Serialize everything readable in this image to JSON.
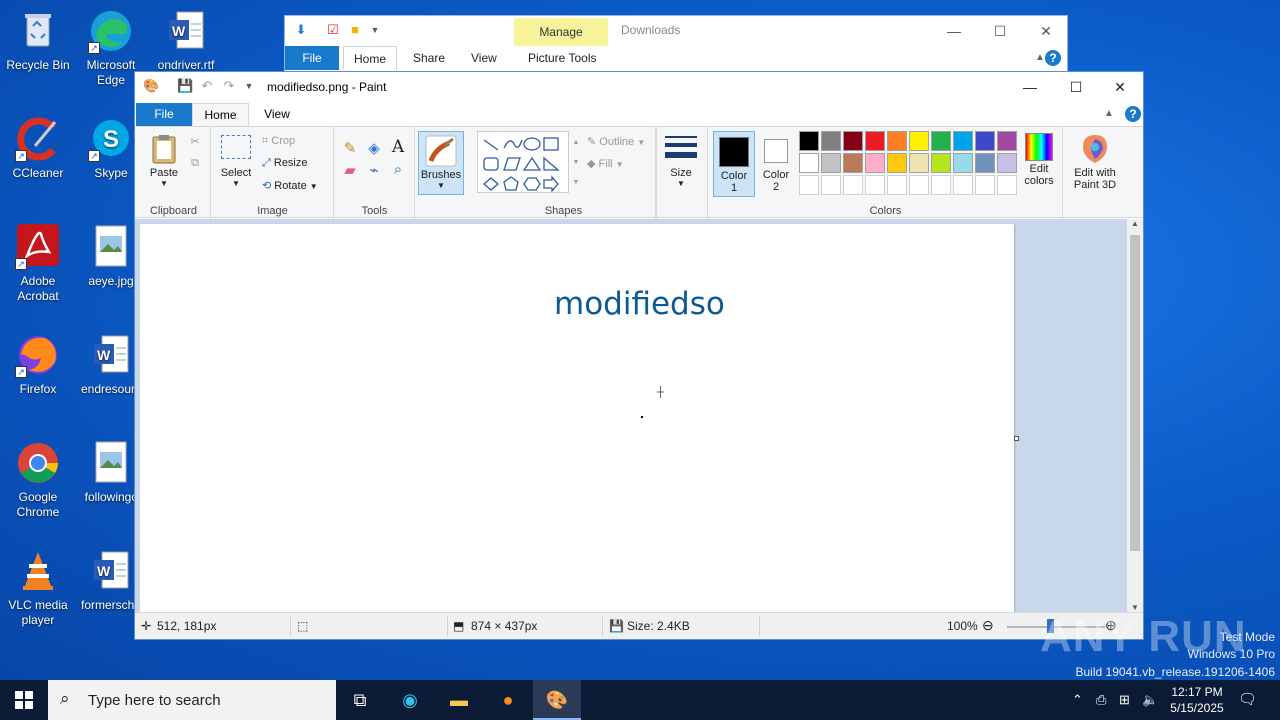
{
  "desktop": {
    "icons": [
      {
        "label1": "Recycle Bin",
        "label2": "",
        "icon": "recycle-bin-icon"
      },
      {
        "label1": "Microsoft",
        "label2": "Edge",
        "icon": "edge-icon"
      },
      {
        "label1": "ondriver.rtf",
        "label2": "",
        "icon": "word-doc-icon"
      },
      {
        "label1": "CCleaner",
        "label2": "",
        "icon": "ccleaner-icon"
      },
      {
        "label1": "Skype",
        "label2": "",
        "icon": "skype-icon"
      },
      {
        "label1": "Adobe",
        "label2": "Acrobat",
        "icon": "acrobat-icon"
      },
      {
        "label1": "aeye.jpg",
        "label2": "",
        "icon": "image-file-icon"
      },
      {
        "label1": "Firefox",
        "label2": "",
        "icon": "firefox-icon"
      },
      {
        "label1": "endresourc",
        "label2": "",
        "icon": "word-doc-icon"
      },
      {
        "label1": "Google",
        "label2": "Chrome",
        "icon": "chrome-icon"
      },
      {
        "label1": "followingc",
        "label2": "",
        "icon": "image-file-icon"
      },
      {
        "label1": "VLC media",
        "label2": "player",
        "icon": "vlc-icon"
      },
      {
        "label1": "formerscho",
        "label2": "",
        "icon": "word-doc-icon"
      }
    ]
  },
  "explorer": {
    "manage": "Manage",
    "title": "Downloads",
    "tabs": {
      "file": "File",
      "home": "Home",
      "share": "Share",
      "view": "View",
      "picture_tools": "Picture Tools"
    }
  },
  "paint": {
    "title": "modifiedso.png - Paint",
    "tabs": {
      "file": "File",
      "home": "Home",
      "view": "View"
    },
    "clipboard": {
      "paste": "Paste",
      "group": "Clipboard"
    },
    "image": {
      "select": "Select",
      "crop": "Crop",
      "resize": "Resize",
      "rotate": "Rotate",
      "group": "Image"
    },
    "tools": {
      "group": "Tools"
    },
    "brushes": "Brushes",
    "shapes": {
      "outline": "Outline",
      "fill": "Fill",
      "group": "Shapes"
    },
    "size": "Size",
    "color1": {
      "l1": "Color",
      "l2": "1"
    },
    "color2": {
      "l1": "Color",
      "l2": "2"
    },
    "colors_group": "Colors",
    "edit_colors": {
      "l1": "Edit",
      "l2": "colors"
    },
    "paint3d": {
      "l1": "Edit with",
      "l2": "Paint 3D"
    },
    "palette_row1": [
      "#000000",
      "#7f7f7f",
      "#880015",
      "#ed1c24",
      "#ff7f27",
      "#fff200",
      "#22b14c",
      "#00a2e8",
      "#3f48cc",
      "#a349a4"
    ],
    "palette_row2": [
      "#ffffff",
      "#c3c3c3",
      "#b97a57",
      "#ffaec9",
      "#ffc90e",
      "#efe4b0",
      "#b5e61d",
      "#99d9ea",
      "#7092be",
      "#c8bfe7"
    ],
    "canvas_text": "modifiedso",
    "status": {
      "position": "512, 181px",
      "dimensions": "874 × 437px",
      "size": "Size: 2.4KB",
      "zoom": "100%"
    }
  },
  "taskbar": {
    "search_placeholder": "Type here to search",
    "time": "12:17 PM",
    "date": "5/15/2025"
  },
  "watermark": {
    "brand": "ANY RUN",
    "line1": "Test Mode",
    "line2": "Windows 10 Pro",
    "line3": "Build 19041.vb_release.191206-1406"
  }
}
